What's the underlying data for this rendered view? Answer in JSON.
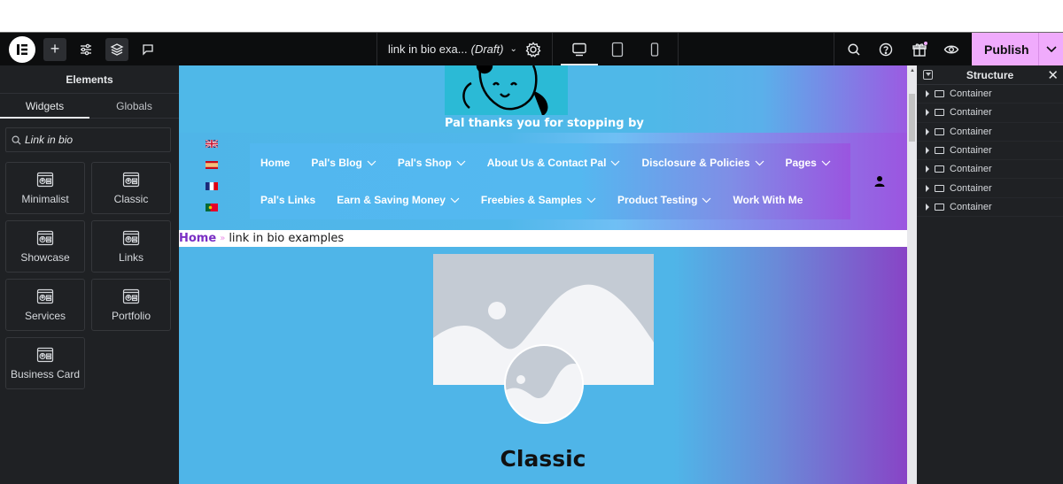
{
  "topbar": {
    "logo": "elementor-logo",
    "left_icons": [
      "plus-icon",
      "sliders-icon",
      "layers-icon",
      "comment-icon"
    ],
    "document_title": "link in bio exa...",
    "document_status": "(Draft)",
    "devices": [
      "desktop",
      "tablet",
      "mobile"
    ],
    "active_device": "desktop",
    "right_icons": [
      "search-icon",
      "help-icon",
      "gift-icon",
      "eye-icon"
    ],
    "publish_label": "Publish",
    "accent_color": "#f0abfc"
  },
  "left_panel": {
    "title": "Elements",
    "tabs": [
      {
        "label": "Widgets",
        "active": true
      },
      {
        "label": "Globals",
        "active": false
      }
    ],
    "search_value": "Link in bio",
    "widgets": [
      {
        "label": "Minimalist"
      },
      {
        "label": "Classic"
      },
      {
        "label": "Showcase"
      },
      {
        "label": "Links"
      },
      {
        "label": "Services"
      },
      {
        "label": "Portfolio"
      },
      {
        "label": "Business Card"
      }
    ]
  },
  "canvas": {
    "tagline": "Pal thanks you for stopping by",
    "flags": [
      "uk-flag",
      "spain-flag",
      "france-flag",
      "portugal-flag"
    ],
    "nav_row1": [
      {
        "label": "Home",
        "dropdown": false
      },
      {
        "label": "Pal's Blog",
        "dropdown": true
      },
      {
        "label": "Pal's Shop",
        "dropdown": true
      },
      {
        "label": "About Us & Contact Pal",
        "dropdown": true
      },
      {
        "label": "Disclosure & Policies",
        "dropdown": true
      },
      {
        "label": "Pages",
        "dropdown": true
      }
    ],
    "nav_row2": [
      {
        "label": "Pal's Links",
        "dropdown": false
      },
      {
        "label": "Earn & Saving Money",
        "dropdown": true
      },
      {
        "label": "Freebies & Samples",
        "dropdown": true
      },
      {
        "label": "Product Testing",
        "dropdown": true
      },
      {
        "label": "Work With Me",
        "dropdown": false
      }
    ],
    "breadcrumb": {
      "home": "Home",
      "separator": "»",
      "current": "link in bio examples"
    },
    "widget_title": "Classic"
  },
  "right_panel": {
    "title": "Structure",
    "items": [
      "Container",
      "Container",
      "Container",
      "Container",
      "Container",
      "Container",
      "Container"
    ]
  }
}
